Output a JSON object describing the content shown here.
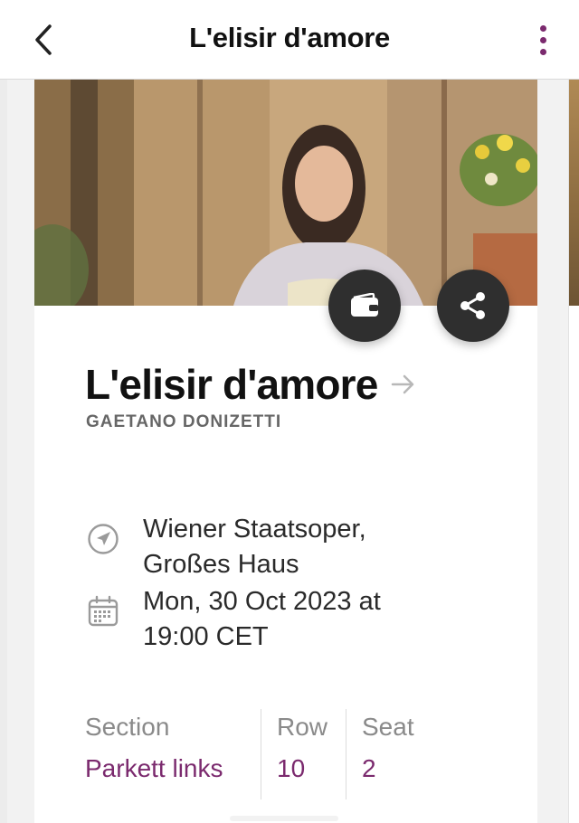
{
  "header": {
    "title": "L'elisir d'amore"
  },
  "ticket": {
    "title": "L'elisir d'amore",
    "composer": "GAETANO DONIZETTI",
    "venue": "Wiener Staatsoper, Großes Haus",
    "datetime": "Mon, 30 Oct 2023 at 19:00 CET",
    "seating": {
      "section_label": "Section",
      "section_value": "Parkett links",
      "row_label": "Row",
      "row_value": "10",
      "seat_label": "Seat",
      "seat_value": "2"
    }
  },
  "icons": {
    "back": "chevron-left-icon",
    "more": "more-vertical-icon",
    "wallet": "wallet-icon",
    "share": "share-icon",
    "title_arrow": "arrow-right-icon",
    "venue": "location-arrow-icon",
    "date": "calendar-icon"
  },
  "colors": {
    "accent": "#7b2a6e",
    "fab": "#2f2f2f"
  }
}
